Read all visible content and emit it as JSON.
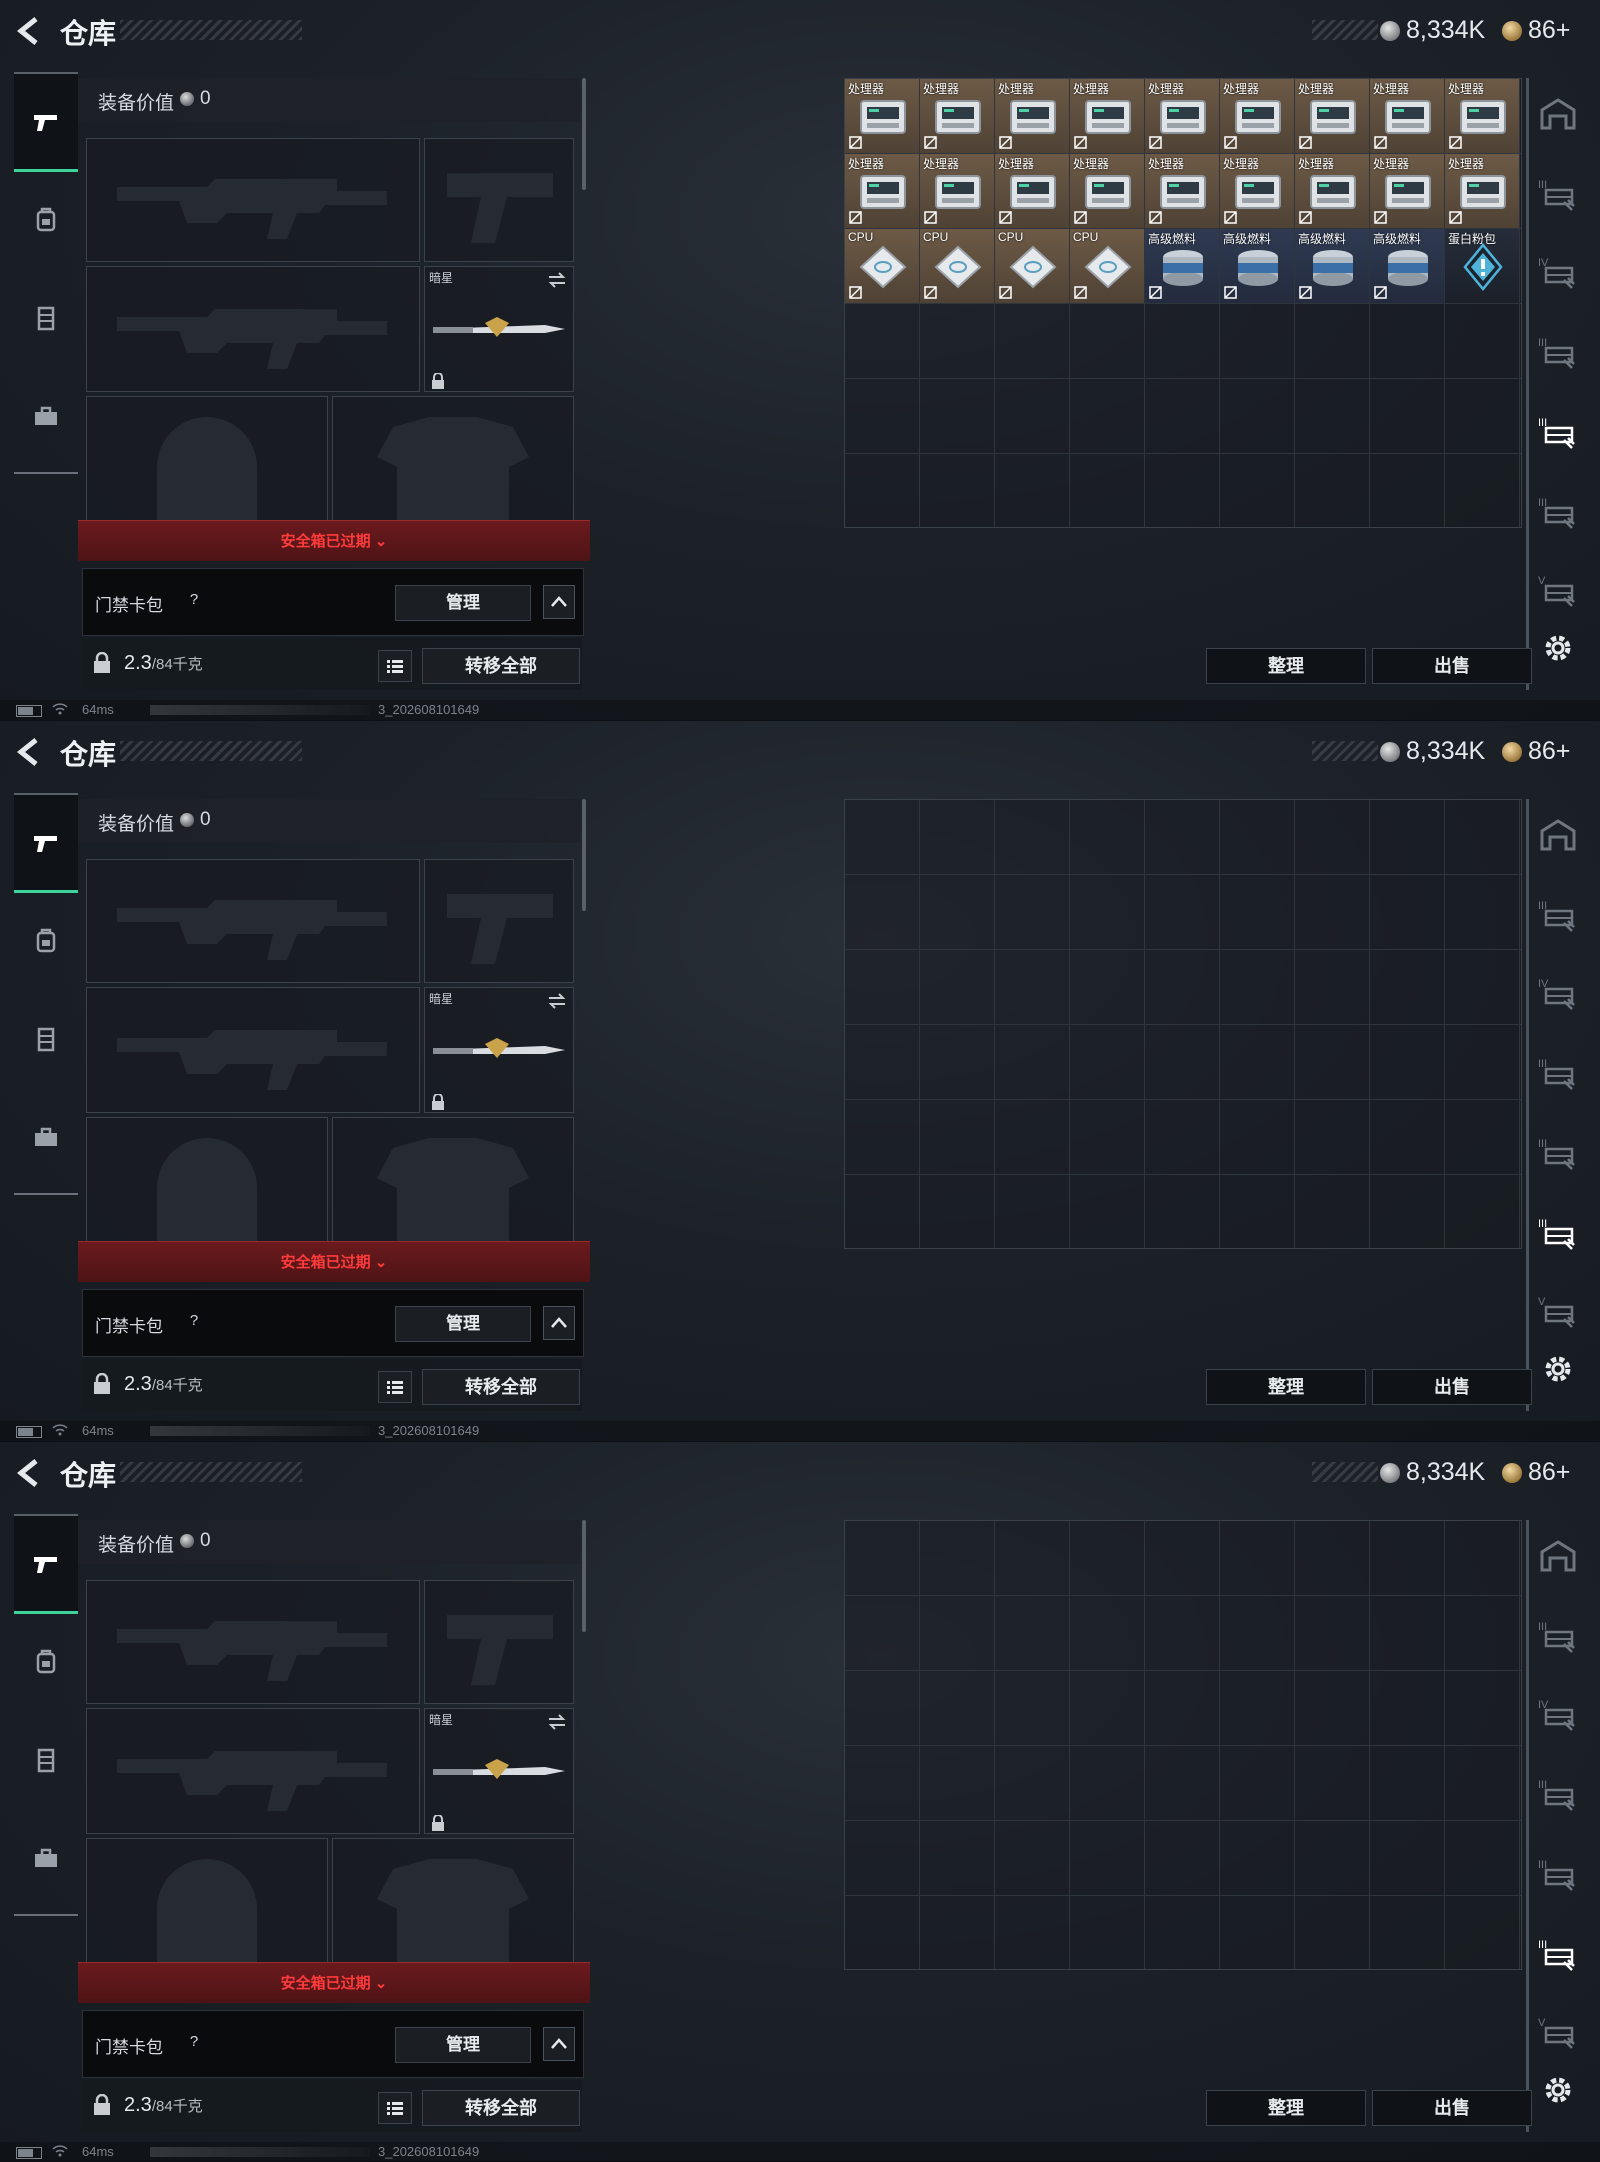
{
  "screens": [
    {
      "topbar": {
        "title": "仓库",
        "silver": "8,334K",
        "gold": "86+"
      },
      "equipment": {
        "title": "装备价值",
        "value": "0",
        "melee_label": "暗星",
        "safebox_status": "安全箱已过期",
        "card_bag_label": "门禁卡包",
        "help": "?",
        "manage": "管理",
        "weight": "2.3",
        "weight_unit": "/84千克",
        "transfer_all": "转移全部"
      },
      "status": {
        "ping": "64ms",
        "build": "3_202608101649"
      },
      "warehouse": {
        "items": [
          {
            "name": "处理器",
            "kind": "proc"
          },
          {
            "name": "处理器",
            "kind": "proc"
          },
          {
            "name": "处理器",
            "kind": "proc"
          },
          {
            "name": "处理器",
            "kind": "proc"
          },
          {
            "name": "处理器",
            "kind": "proc"
          },
          {
            "name": "处理器",
            "kind": "proc"
          },
          {
            "name": "处理器",
            "kind": "proc"
          },
          {
            "name": "处理器",
            "kind": "proc"
          },
          {
            "name": "处理器",
            "kind": "proc"
          },
          {
            "name": "处理器",
            "kind": "proc"
          },
          {
            "name": "处理器",
            "kind": "proc"
          },
          {
            "name": "处理器",
            "kind": "proc"
          },
          {
            "name": "处理器",
            "kind": "proc"
          },
          {
            "name": "处理器",
            "kind": "proc"
          },
          {
            "name": "处理器",
            "kind": "proc"
          },
          {
            "name": "处理器",
            "kind": "proc"
          },
          {
            "name": "处理器",
            "kind": "proc"
          },
          {
            "name": "处理器",
            "kind": "proc"
          },
          {
            "name": "CPU",
            "kind": "cpu"
          },
          {
            "name": "CPU",
            "kind": "cpu"
          },
          {
            "name": "CPU",
            "kind": "cpu"
          },
          {
            "name": "CPU",
            "kind": "cpu"
          },
          {
            "name": "高级燃料",
            "kind": "fuel"
          },
          {
            "name": "高级燃料",
            "kind": "fuel"
          },
          {
            "name": "高级燃料",
            "kind": "fuel"
          },
          {
            "name": "高级燃料",
            "kind": "fuel"
          },
          {
            "name": "蛋白粉包",
            "kind": "protein"
          }
        ],
        "active_filter": "III"
      },
      "actions": {
        "sort": "整理",
        "sell": "出售"
      }
    },
    {
      "topbar": {
        "title": "仓库",
        "silver": "8,334K",
        "gold": "86+"
      },
      "equipment": {
        "title": "装备价值",
        "value": "0",
        "melee_label": "暗星",
        "safebox_status": "安全箱已过期",
        "card_bag_label": "门禁卡包",
        "help": "?",
        "manage": "管理",
        "weight": "2.3",
        "weight_unit": "/84千克",
        "transfer_all": "转移全部"
      },
      "status": {
        "ping": "64ms",
        "build": "3_202608101649"
      },
      "warehouse": {
        "items": [],
        "active_filter": "III"
      },
      "actions": {
        "sort": "整理",
        "sell": "出售"
      }
    },
    {
      "topbar": {
        "title": "仓库",
        "silver": "8,334K",
        "gold": "86+"
      },
      "equipment": {
        "title": "装备价值",
        "value": "0",
        "melee_label": "暗星",
        "safebox_status": "安全箱已过期",
        "card_bag_label": "门禁卡包",
        "help": "?",
        "manage": "管理",
        "weight": "2.3",
        "weight_unit": "/84千克",
        "transfer_all": "转移全部"
      },
      "status": {
        "ping": "64ms",
        "build": "3_202608101649"
      },
      "warehouse": {
        "items": [],
        "active_filter": "III"
      },
      "actions": {
        "sort": "整理",
        "sell": "出售"
      }
    }
  ],
  "filters": [
    {
      "label": "",
      "icon": "base-icon"
    },
    {
      "label": "III",
      "icon": "rack-icon"
    },
    {
      "label": "IV",
      "icon": "rack-icon"
    },
    {
      "label": "III",
      "icon": "rack-icon"
    },
    {
      "label": "III",
      "icon": "rack-icon"
    },
    {
      "label": "III",
      "icon": "rack-icon"
    },
    {
      "label": "V",
      "icon": "rack-icon"
    }
  ],
  "colors": {
    "accent": "#3fd29a",
    "alert": "#ff3b3b"
  }
}
